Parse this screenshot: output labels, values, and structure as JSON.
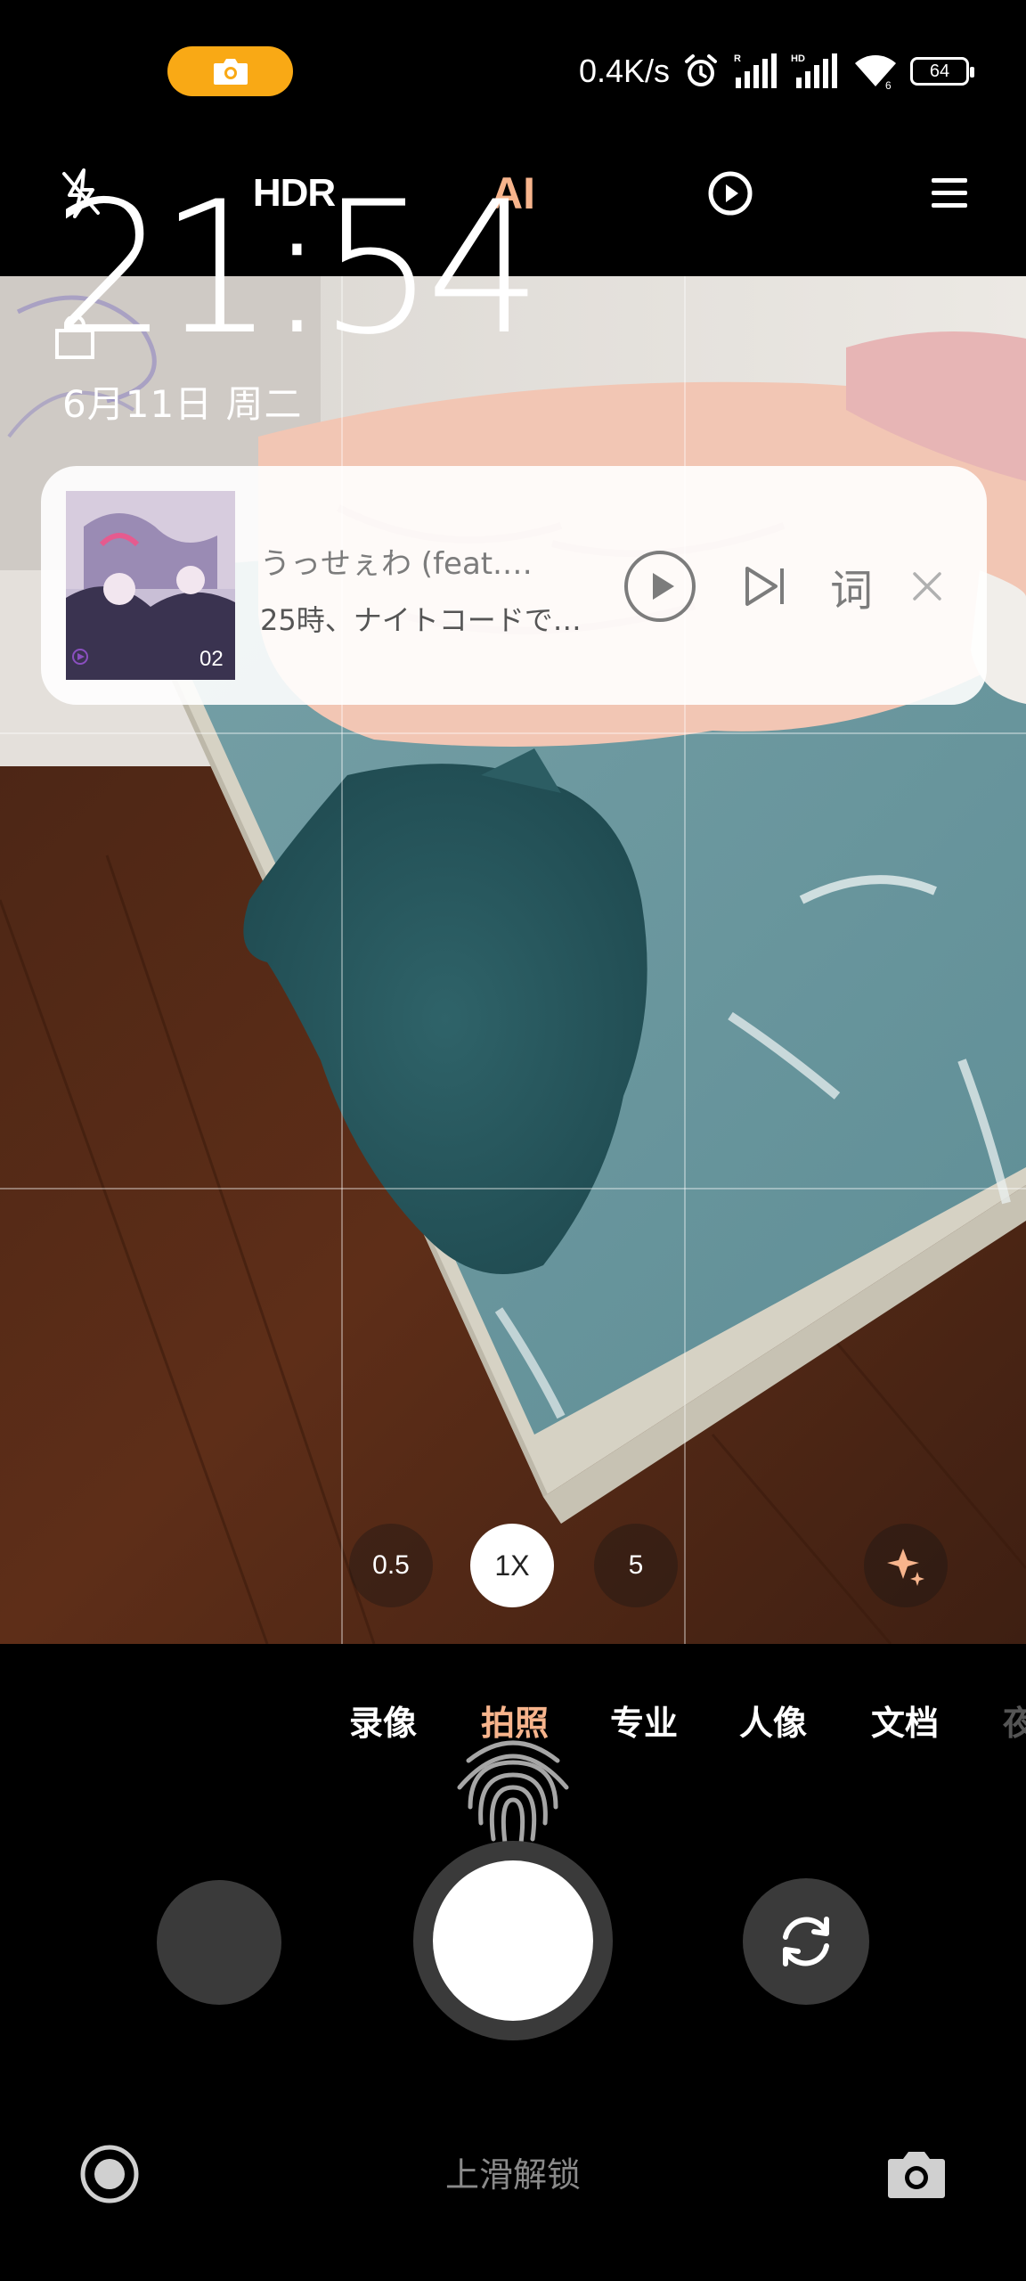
{
  "status_bar": {
    "net_speed": "0.4K/s",
    "battery_level": "64",
    "signal_1_label": "R",
    "signal_2_label": "HD"
  },
  "toolbar": {
    "hdr_label": "HDR",
    "ai_label": "AI"
  },
  "lock_screen": {
    "time": "21:54",
    "date": "6月11日 周二"
  },
  "music": {
    "title": "うっせぇわ (feat.…",
    "artist": "25時、ナイトコードで…",
    "album_vol": "02",
    "lyrics_label": "词"
  },
  "zoom": {
    "options": [
      "0.5",
      "1X",
      "5"
    ],
    "active": "1X"
  },
  "modes": {
    "items": [
      "录像",
      "拍照",
      "专业",
      "人像",
      "文档",
      "夜"
    ],
    "active": "拍照"
  },
  "bottom": {
    "unlock_hint": "上滑解锁"
  },
  "colors": {
    "accent": "#f7b48c",
    "status_pill": "#f9a915"
  }
}
